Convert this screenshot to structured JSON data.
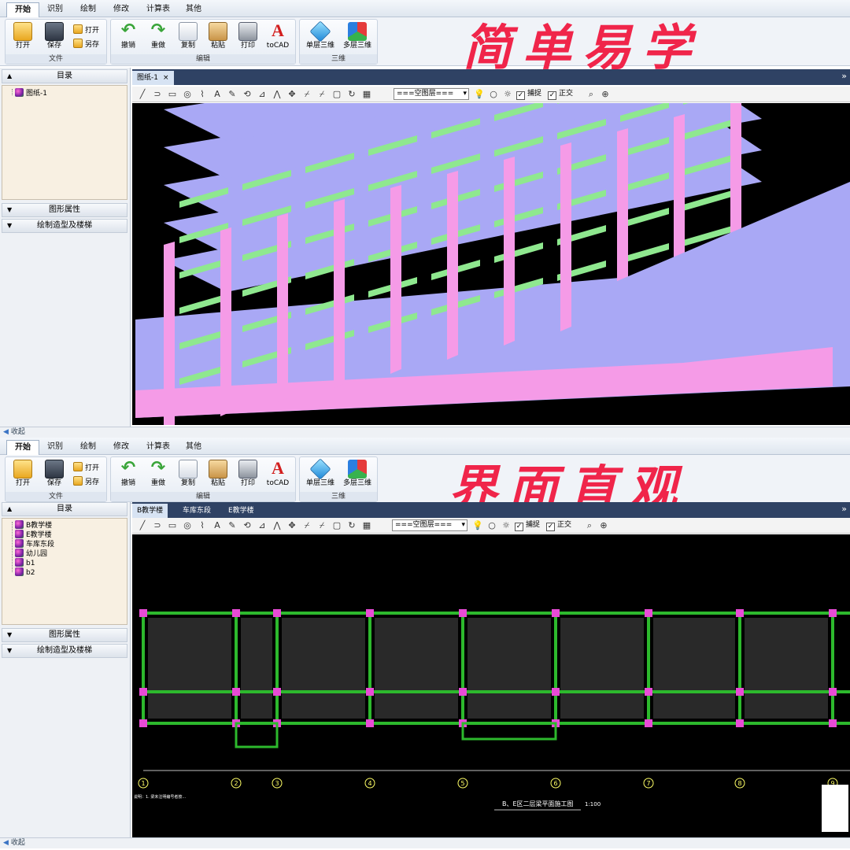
{
  "slogans": {
    "top": "简单易学",
    "bottom": "界面直观"
  },
  "menu_tabs": [
    "开始",
    "识别",
    "绘制",
    "修改",
    "计算表",
    "其他"
  ],
  "ribbon": {
    "file": {
      "group": "文件",
      "open": "打开",
      "save": "保存",
      "open2": "打开",
      "save_as": "另存"
    },
    "edit": {
      "group": "编辑",
      "undo": "撤销",
      "redo": "重做",
      "copy": "复制",
      "paste": "粘贴",
      "print": "打印",
      "tocad": "toCAD"
    },
    "three_d": {
      "group": "三维",
      "single": "单层三维",
      "multi": "多层三维"
    }
  },
  "panel": {
    "catalog": "目录",
    "shape_props": "图形属性",
    "modeling": "绘制造型及楼梯",
    "collapse": "收起"
  },
  "top_view": {
    "tree": [
      "图纸-1"
    ],
    "doc_tabs": [
      {
        "label": "图纸-1",
        "close": "×"
      }
    ]
  },
  "bottom_view": {
    "tree": [
      "B教学楼",
      "E教学楼",
      "车库东段",
      "幼儿园",
      "b1",
      "b2"
    ],
    "doc_tabs": [
      {
        "label": "B教学楼"
      },
      {
        "label": "车库东段"
      },
      {
        "label": "E教学楼"
      }
    ]
  },
  "toolbar": {
    "layer_value": "===空图层===",
    "snap": "捕捉",
    "ortho": "正交",
    "icons": [
      "line-icon",
      "arc-icon",
      "rect-icon",
      "circle-icon",
      "polyline-icon",
      "text-icon",
      "brush-icon",
      "select-icon",
      "mirror-icon",
      "flip-icon",
      "move-icon",
      "trim-icon",
      "extend-icon",
      "offset-icon",
      "rotate-icon",
      "array-icon"
    ]
  },
  "drawing": {
    "note": "说明：1. 梁未注明编号者按...",
    "title": "B、E区二层梁平面施工图",
    "scale": "1:100",
    "axis_labels": [
      "1",
      "2",
      "3",
      "4",
      "5",
      "6",
      "7",
      "8",
      "9"
    ]
  },
  "colors": {
    "column": "#f59be7",
    "beam": "#8fe88f",
    "slab": "#a9a8f5",
    "accent": "#f0254a",
    "grid": "#2db92d"
  },
  "more_glyph": "»"
}
